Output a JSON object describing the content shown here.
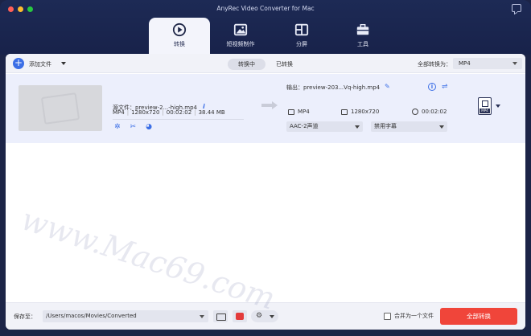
{
  "window": {
    "title": "AnyRec Video Converter for Mac",
    "traffic_colors": [
      "#ff5f57",
      "#febc2e",
      "#28c840"
    ]
  },
  "nav_tabs": [
    {
      "label": "转换",
      "icon": "convert-icon",
      "active": true
    },
    {
      "label": "短视频制作",
      "icon": "image-icon",
      "active": false
    },
    {
      "label": "分屏",
      "icon": "split-screen-icon",
      "active": false
    },
    {
      "label": "工具",
      "icon": "toolbox-icon",
      "active": false
    }
  ],
  "toolbar": {
    "add_files": "添加文件",
    "segments": [
      "转换中",
      "已转换"
    ],
    "convert_all_to_label": "全部转换为：",
    "convert_all_format": "MP4"
  },
  "file": {
    "source_label": "源文件：preview-2...-high.mp4",
    "source_meta": [
      "MP4",
      "1280x720",
      "00:02:02",
      "38.44 MB"
    ],
    "output_label": "输出：preview-203...Vq-high.mp4",
    "output_format": "MP4",
    "output_resolution": "1280x720",
    "output_duration": "00:02:02",
    "audio_track": "AAC-2声道",
    "subtitle": "禁用字幕",
    "format_badge": "MP4"
  },
  "bottom": {
    "save_to_label": "保存至：",
    "save_path": "/Users/macos/Movies/Converted",
    "merge_label": "合并为一个文件",
    "convert_all_button": "全部转换"
  },
  "watermark": "www.Mac69.com",
  "colors": {
    "accent": "#3c6fe6",
    "convert_button": "#f0453a",
    "navbar": "#1d2a55"
  }
}
